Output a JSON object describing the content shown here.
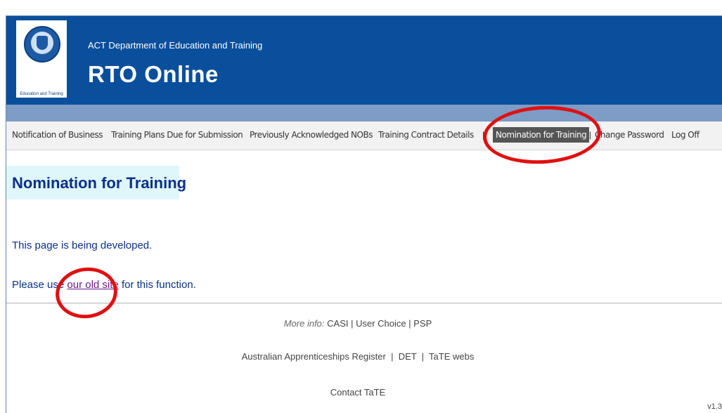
{
  "header": {
    "logo_caption": "Education and Training",
    "department": "ACT Department of Education and Training",
    "title": "RTO Online"
  },
  "nav": {
    "items": [
      {
        "label": "Notification of Business"
      },
      {
        "label": "Training Plans Due for Submission"
      },
      {
        "label": "Previously Acknowledged NOBs"
      },
      {
        "label": "Training Contract Details"
      },
      {
        "label": "Nomination for Training",
        "active": true
      },
      {
        "label": "Change Password"
      },
      {
        "label": "Log Off"
      }
    ]
  },
  "main": {
    "heading": "Nomination for Training",
    "developing_text": "This page is being developed.",
    "use_prefix": "Please use",
    "old_site_link": "our old site",
    "use_suffix": "for this function."
  },
  "footer": {
    "more_info_label": "More info:",
    "more_info_links": [
      "CASI",
      "User Choice",
      "PSP"
    ],
    "links": [
      "Australian Apprenticeships Register",
      "DET",
      "TaTE webs"
    ],
    "contact": "Contact TaTE",
    "version": "v1.3"
  },
  "colors": {
    "header_bg": "#0a4f9c",
    "strip_bg": "#7d9cc6",
    "active_tab_bg": "#555555",
    "heading_bg": "#dff7fb",
    "text_blue": "#0b2f8a",
    "annotation_red": "#e01010"
  }
}
